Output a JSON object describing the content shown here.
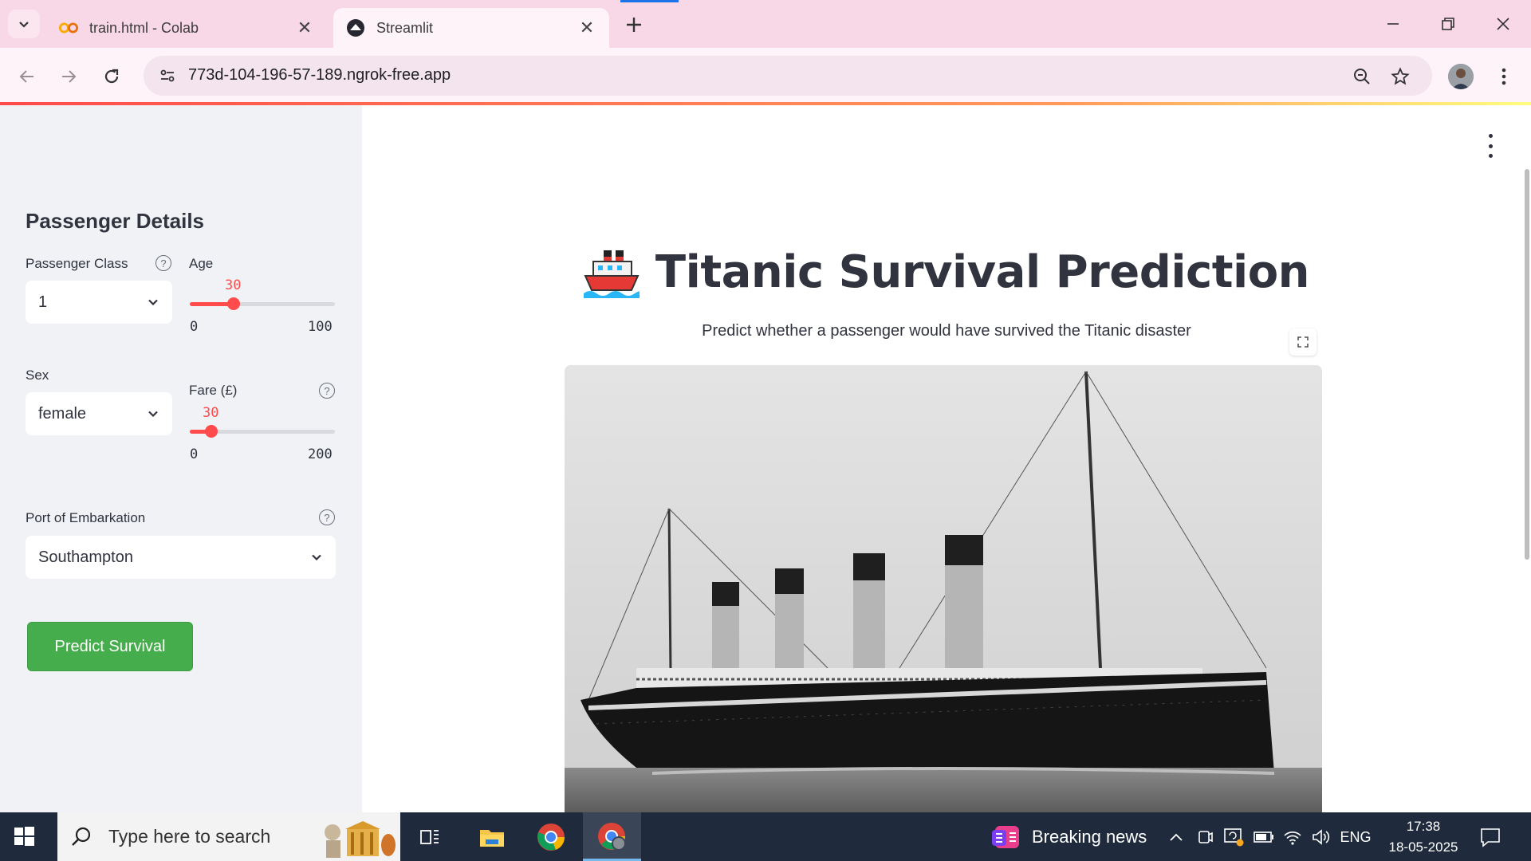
{
  "browser": {
    "tabs": [
      {
        "title": "train.html - Colab",
        "icon": "colab-icon",
        "active": false
      },
      {
        "title": "Streamlit",
        "icon": "streamlit-icon",
        "active": true
      }
    ],
    "url": "773d-104-196-57-189.ngrok-free.app"
  },
  "sidebar": {
    "heading": "Passenger Details",
    "passenger_class": {
      "label": "Passenger Class",
      "value": "1"
    },
    "age": {
      "label": "Age",
      "value": "30",
      "min": "0",
      "max": "100",
      "fraction": 0.3
    },
    "sex": {
      "label": "Sex",
      "value": "female"
    },
    "fare": {
      "label": "Fare (£)",
      "value": "30",
      "min": "0",
      "max": "200",
      "fraction": 0.15
    },
    "port": {
      "label": "Port of Embarkation",
      "value": "Southampton"
    },
    "predict_button": "Predict Survival",
    "help_icon": "question-circle-icon"
  },
  "main": {
    "title_emoji": "ship-emoji",
    "title": "Titanic Survival Prediction",
    "subtitle": "Predict whether a passenger would have survived the Titanic disaster",
    "image_subject": "titanic-ship-photo"
  },
  "taskbar": {
    "search_placeholder": "Type here to search",
    "news": "Breaking news",
    "language": "ENG",
    "time": "17:38",
    "date": "18-05-2025"
  },
  "colors": {
    "accent": "#ff4b4b",
    "button_green": "#46ad4c",
    "sidebar_bg": "#f0f2f6",
    "tabstrip_bg": "#f8d7e6"
  }
}
